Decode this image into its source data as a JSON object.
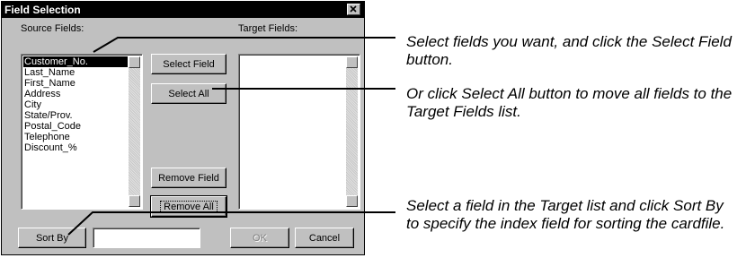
{
  "dialog": {
    "title": "Field Selection",
    "source_label": "Source Fields:",
    "target_label": "Target Fields:",
    "source_fields": [
      "Customer_No.",
      "Last_Name",
      "First_Name",
      "Address",
      "City",
      "State/Prov.",
      "Postal_Code",
      "Telephone",
      "Discount_%"
    ],
    "selected_index": 0,
    "target_fields": [],
    "buttons": {
      "select_field": "Select Field",
      "select_all": "Select All",
      "remove_field": "Remove Field",
      "remove_all": "Remove All",
      "sort_by": "Sort By",
      "ok": "OK",
      "cancel": "Cancel"
    },
    "sort_by_value": ""
  },
  "annotations": {
    "select_field": "Select fields you want, and click the Select Field button.",
    "select_all": "Or click Select All button to move all fields to the Target Fields list.",
    "sort_by": "Select a field in the Target list and click Sort By to specify the index field for sorting the cardfile."
  }
}
